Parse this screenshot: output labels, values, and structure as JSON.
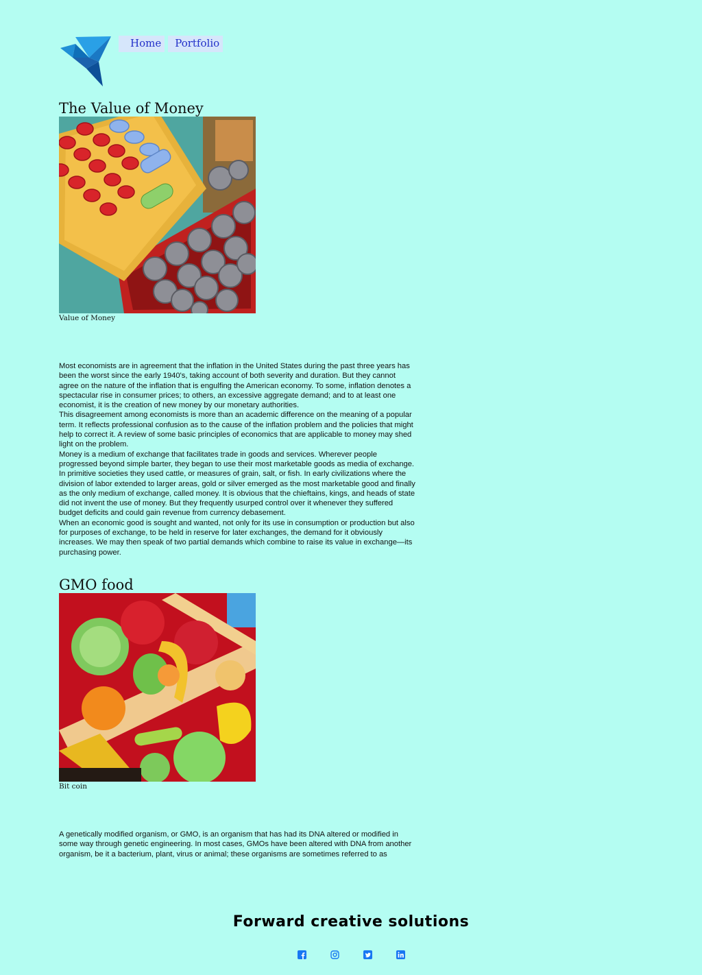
{
  "nav": {
    "items": [
      "Home",
      "Portfolio"
    ]
  },
  "articles": [
    {
      "title": "The Value of Money",
      "caption": "Value of Money",
      "paragraphs": [
        "Most economists are in agreement that the inflation in the United States during the past three years has been the worst since the early 1940's, taking account of both severity and duration. But they cannot agree on the nature of the inflation that is engulfing the American economy. To some, inflation denotes a spectacular rise in consumer prices; to others, an excessive aggregate demand; and to at least one economist, it is the creation of new money by our monetary authorities.",
        "This disagreement among economists is more than an academic difference on the meaning of a popular term. It reflects professional confusion as to the cause of the inflation problem and the policies that might help to correct it. A review of some basic principles of economics that are applicable to money may shed light on the problem.",
        "Money is a medium of exchange that facilitates trade in goods and services. Wherever people progressed beyond simple barter, they began to use their most marketable goods as media of exchange. In primitive societies they used cattle, or measures of grain, salt, or fish. In early civilizations where the division of labor extended to larger areas, gold or silver emerged as the most marketable good and finally as the only medium of exchange, called money. It is obvious that the chieftains, kings, and heads of state did not invent the use of money. But they frequently usurped control over it whenever they suffered budget deficits and could gain revenue from currency debasement.",
        "When an economic good is sought and wanted, not only for its use in consumption or production but also for purposes of exchange, to be held in reserve for later exchanges, the demand for it obviously increases. We may then speak of two partial demands which combine to raise its value in exchange—its purchasing power."
      ]
    },
    {
      "title": "GMO food",
      "caption": "Bit coin",
      "paragraphs": [
        "A genetically modified organism, or GMO, is an organism that has had its DNA altered or modified in some way through genetic engineering. In most cases, GMOs have been altered with DNA from another organism, be it a bacterium, plant, virus or animal; these organisms are sometimes referred to as \"transgenic\" organisms. Genetics from a spider that helps the arachnid produce silk, for example,"
      ]
    }
  ],
  "footer": {
    "title": "Forward creative solutions",
    "social": [
      "facebook-icon",
      "instagram-icon",
      "twitter-icon",
      "linkedin-icon"
    ]
  },
  "colors": {
    "background": "#b4fdf2",
    "nav_bg": "#d6e6fb",
    "nav_text": "#2230c9",
    "icon_blue": "#1877f2"
  }
}
